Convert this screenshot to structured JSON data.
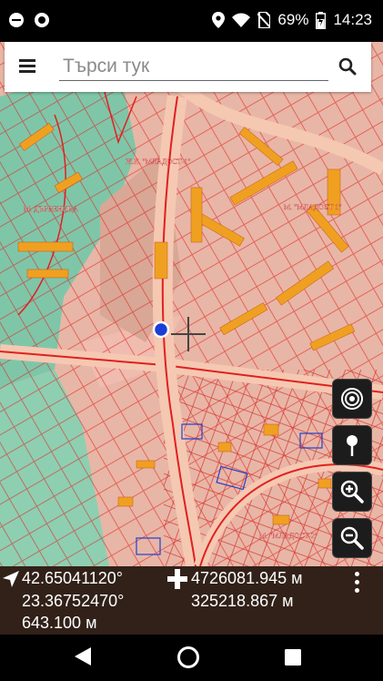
{
  "status_bar": {
    "battery": "69%",
    "time": "14:23",
    "icons": [
      "minus-circle-icon",
      "stop-circle-icon",
      "location-icon",
      "wifi-icon",
      "no-sim-icon",
      "battery-icon"
    ]
  },
  "search": {
    "placeholder": "Търси тук",
    "value": ""
  },
  "map": {
    "labels": [
      "Ж.К. \"МЛАДОСТ-1\"",
      "М. ДЪРВЕНИЦА",
      "М. \"МЛАДОСТ 1\"",
      "М. \"МЛАДОСТ-2\""
    ],
    "location_marker_color": "#1a3fd6"
  },
  "map_controls": {
    "buttons": [
      "target-icon",
      "pin-icon",
      "zoom-in-icon",
      "zoom-out-icon"
    ]
  },
  "coordinates": {
    "latitude": "42.65041120°",
    "longitude": "23.36752470°",
    "altitude": "643.100 м",
    "northing": "4726081.945 м",
    "easting": "325218.867 м"
  },
  "colors": {
    "accent": "#ffffff",
    "panel": "#3c281e"
  }
}
